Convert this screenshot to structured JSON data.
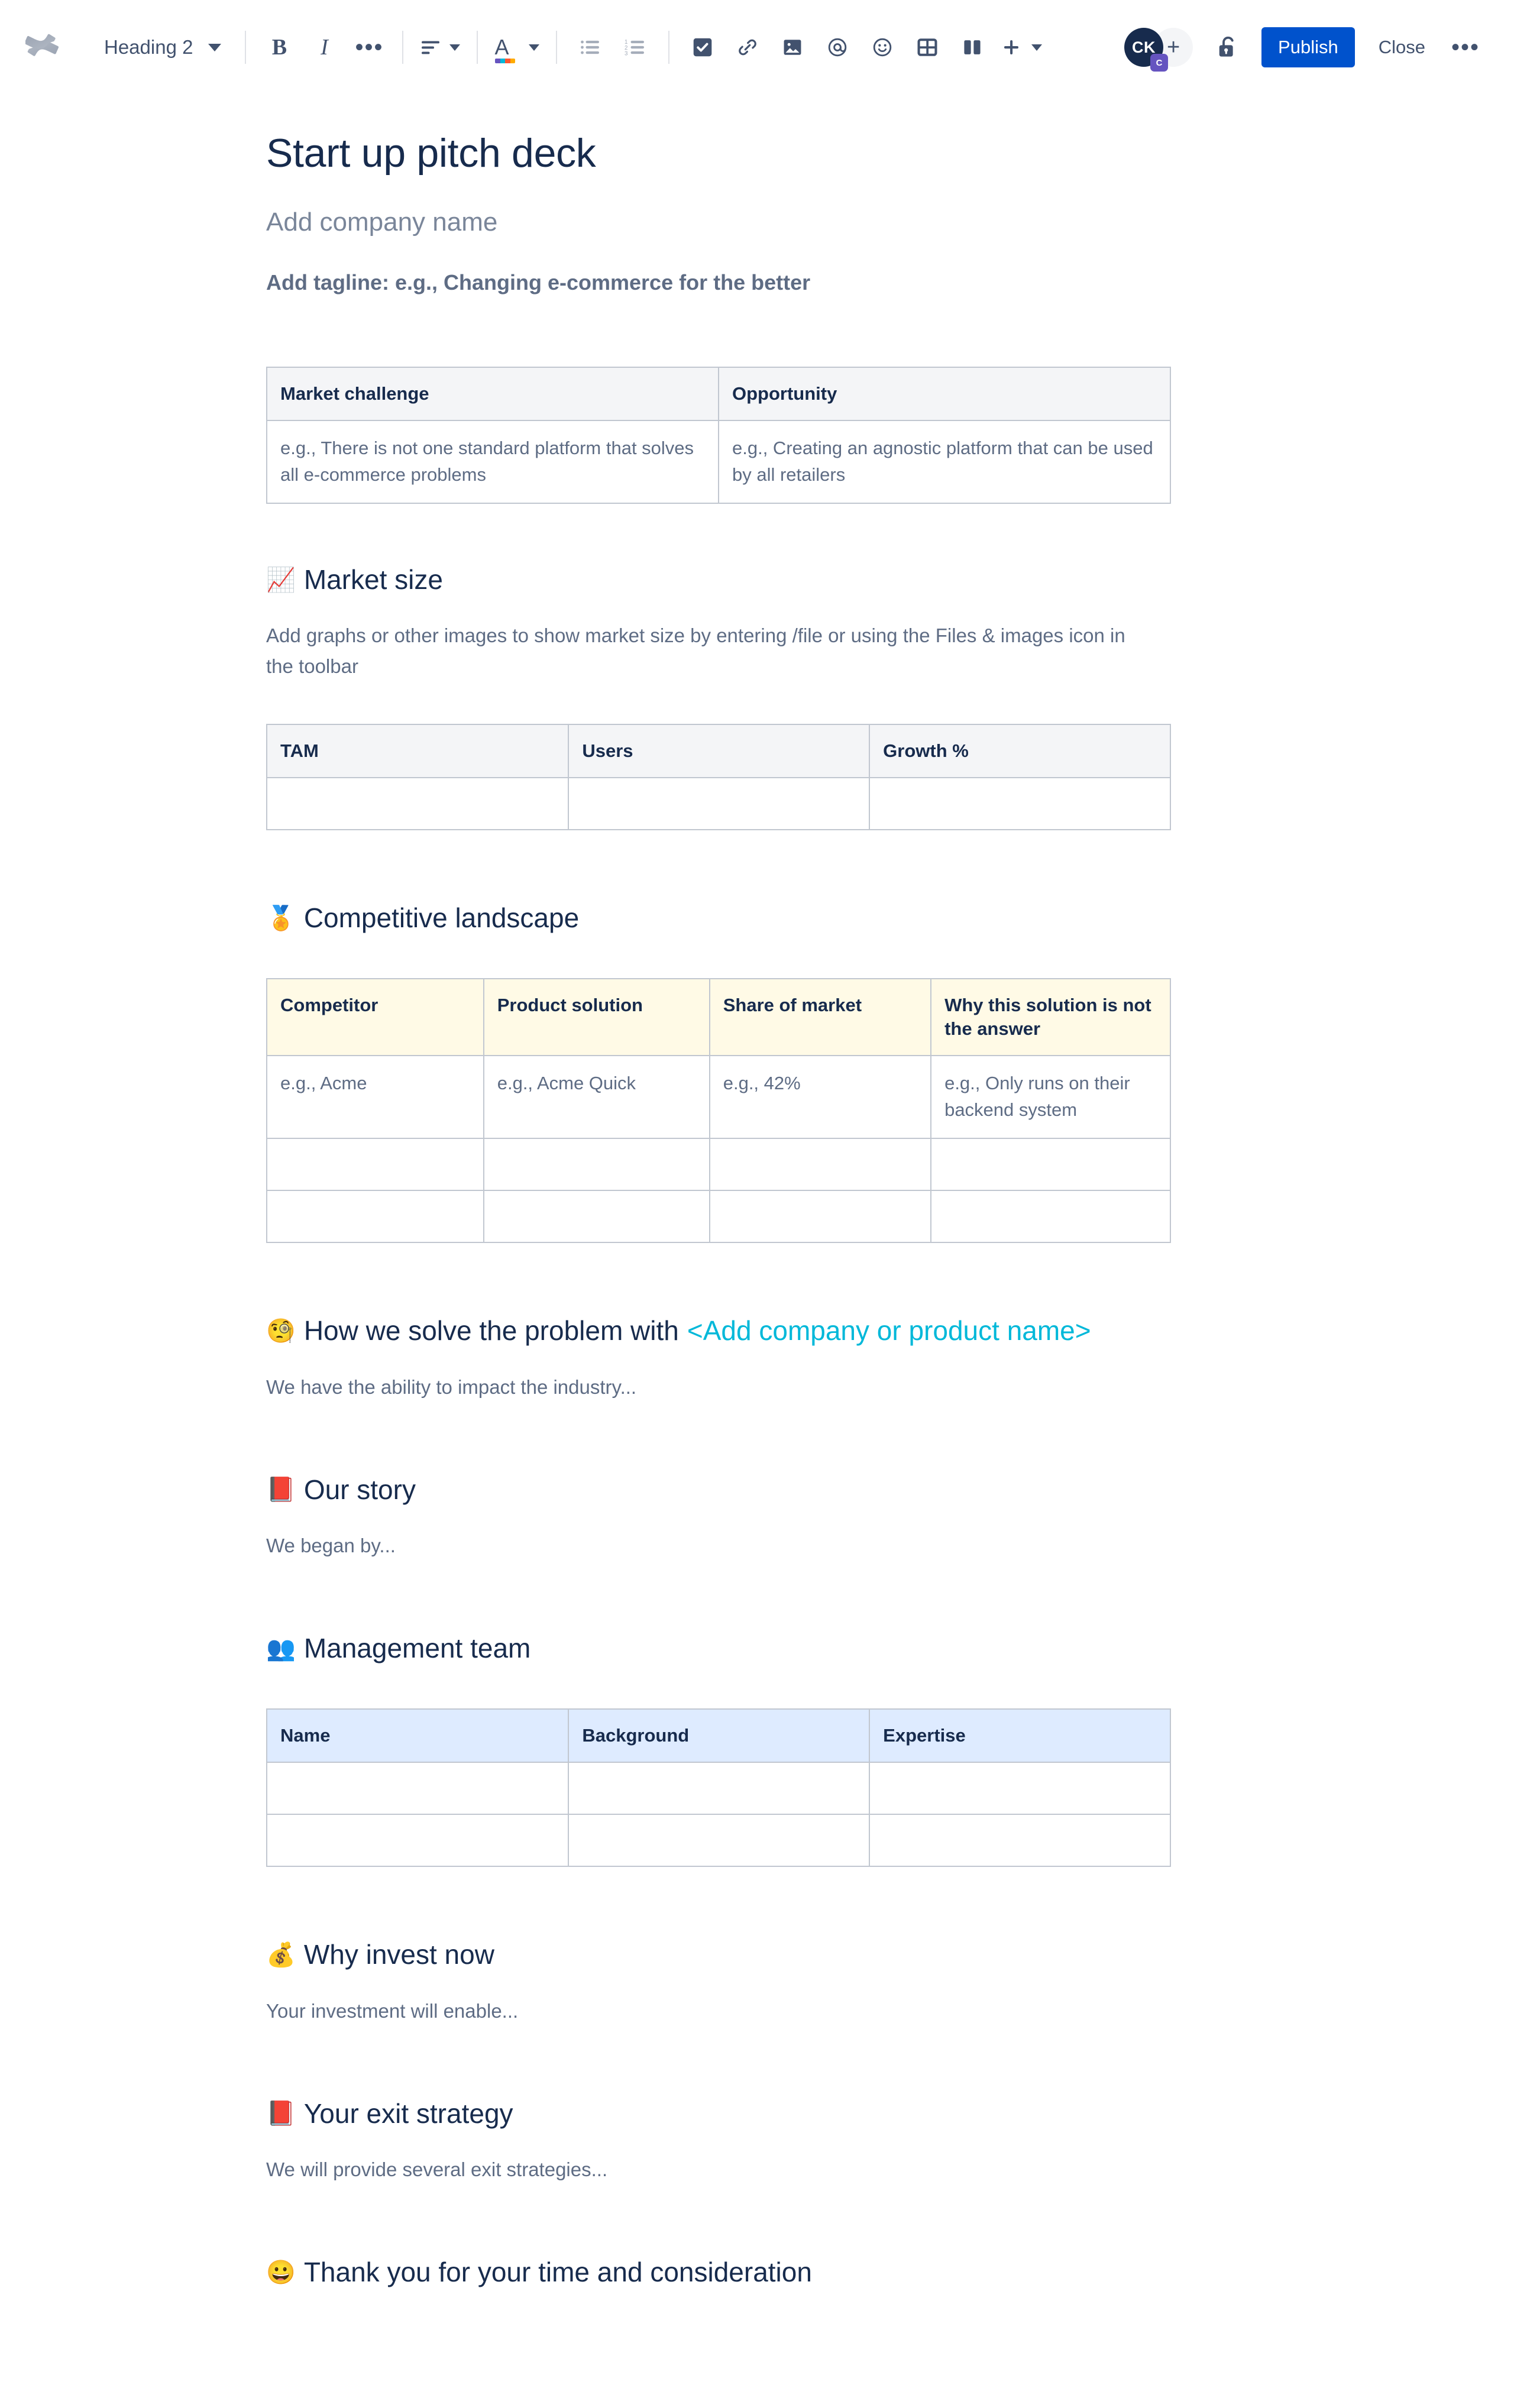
{
  "toolbar": {
    "logo_name": "confluence-logo",
    "heading_select": {
      "value": "Heading 2"
    },
    "buttons": {
      "bold": "B",
      "italic": "I",
      "more_formatting": "•••",
      "align": "align",
      "text_color": "A",
      "bullet_list": "bullet-list",
      "numbered_list": "numbered-list",
      "action_item": "action-item",
      "link": "link",
      "image": "image",
      "mention": "mention",
      "emoji": "emoji",
      "table": "table",
      "layout": "layout",
      "insert": "+"
    },
    "avatar": {
      "initials": "CK",
      "badge": "C"
    },
    "add_people": "+",
    "restrictions": "unlock",
    "publish_label": "Publish",
    "close_label": "Close",
    "more_label": "•••"
  },
  "document": {
    "title": "Start up pitch deck",
    "company_placeholder": "Add company name",
    "tagline_placeholder": "Add tagline: e.g., Changing e-commerce for the better",
    "challenge_table": {
      "headers": [
        "Market challenge",
        "Opportunity"
      ],
      "rows": [
        [
          "e.g., There is not one standard platform that solves all e-commerce problems",
          "e.g., Creating an agnostic platform that can be used by all retailers"
        ]
      ]
    },
    "market_size": {
      "emoji": "📈",
      "emoji_name": "chart-increasing-emoji",
      "heading": "Market size",
      "body": "Add graphs or other images to show market size by entering /file or using the Files & images icon in the toolbar",
      "table": {
        "headers": [
          "TAM",
          "Users",
          "Growth %"
        ],
        "rows": [
          [
            "",
            "",
            ""
          ]
        ]
      }
    },
    "competitive_landscape": {
      "emoji": "🏅",
      "emoji_name": "sports-medal-emoji",
      "heading": "Competitive landscape",
      "table": {
        "headers": [
          "Competitor",
          "Product solution",
          "Share of market",
          "Why this solution is not the answer"
        ],
        "rows": [
          [
            "e.g., Acme",
            "e.g., Acme Quick",
            "e.g., 42%",
            "e.g., Only runs on their backend system"
          ],
          [
            "",
            "",
            "",
            ""
          ],
          [
            "",
            "",
            "",
            ""
          ]
        ]
      }
    },
    "how_we_solve": {
      "emoji": "🧐",
      "emoji_name": "face-with-monocle-emoji",
      "heading": "How we solve the problem with ",
      "heading_accent": "<Add company or product name>",
      "body": "We have the ability to impact the industry..."
    },
    "our_story": {
      "emoji": "📕",
      "emoji_name": "closed-book-emoji",
      "heading": "Our story",
      "body": "We began by..."
    },
    "management_team": {
      "emoji": "👥",
      "emoji_name": "busts-in-silhouette-emoji",
      "heading": "Management team",
      "table": {
        "headers": [
          "Name",
          "Background",
          "Expertise"
        ],
        "rows": [
          [
            "",
            "",
            ""
          ],
          [
            "",
            "",
            ""
          ]
        ]
      }
    },
    "why_invest": {
      "emoji": "💰",
      "emoji_name": "money-bag-emoji",
      "heading": "Why invest now",
      "body": "Your investment will enable..."
    },
    "exit_strategy": {
      "emoji": "📕",
      "emoji_name": "closed-book-emoji",
      "heading": "Your exit strategy",
      "body": "We will provide several exit strategies..."
    },
    "thank_you": {
      "emoji": "😀",
      "emoji_name": "grinning-face-emoji",
      "heading": "Thank you for your time and consideration"
    }
  },
  "colors": {
    "brand_blue": "#0052CC",
    "accent_cyan": "#00B8D9",
    "text_dark": "#172B4D",
    "text_muted": "#5E6C84",
    "placeholder": "#7A869A",
    "border": "#C1C7D0",
    "header_grey": "#F4F5F7",
    "header_cream": "#FFFAE6",
    "header_blue": "#DEEBFF",
    "avatar_bg": "#172B4D",
    "badge_purple": "#6554C0"
  }
}
